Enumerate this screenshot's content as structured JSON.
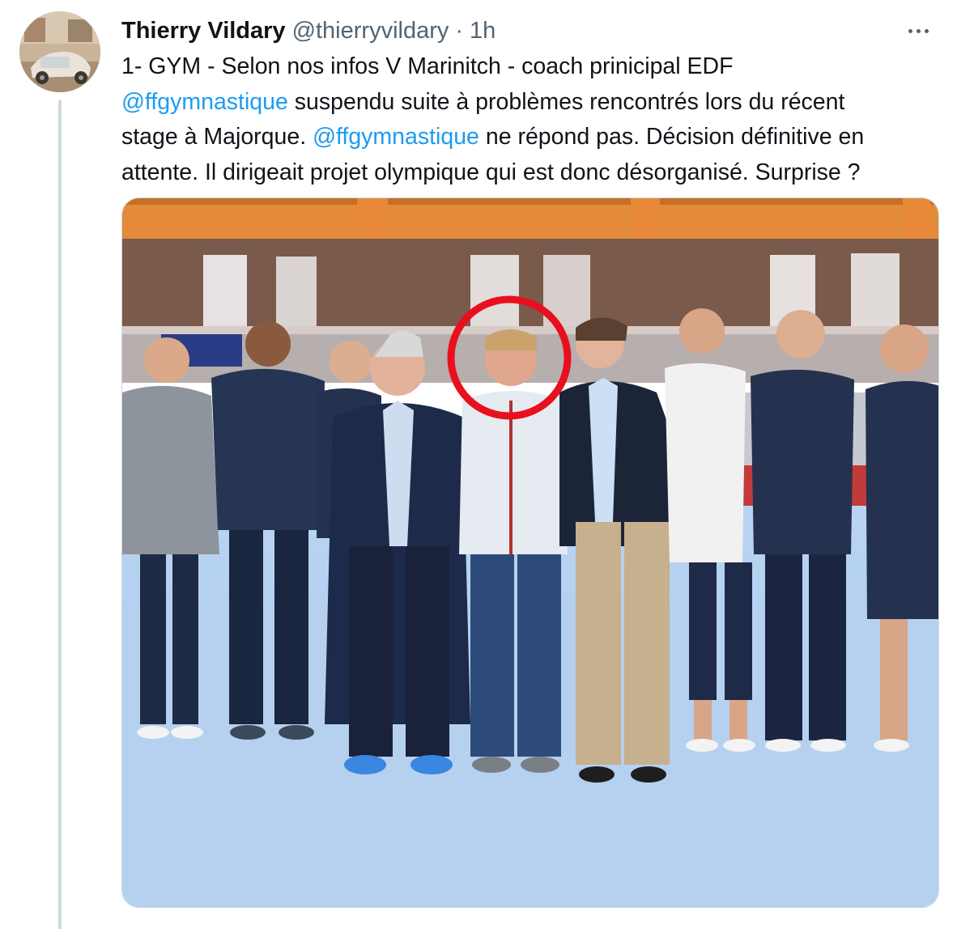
{
  "author": {
    "display_name": "Thierry Vildary",
    "handle": "@thierryvildary",
    "separator": "·",
    "time": "1h",
    "avatar_icon": "avatar-photo"
  },
  "more_icon": "more-horizontal-icon",
  "tweet": {
    "line1": "1- GYM - Selon nos infos V Marinitch - coach prinicipal EDF",
    "line2_mention": "@ffgymnastique",
    "line2_text": " suspendu suite à problèmes rencontrés lors du récent",
    "line3_text": "stage à Majorque. ",
    "line3_mention": "@ffgymnastique",
    "line3_rest": " ne répond pas. Décision définitive en",
    "line4": "attente. Il dirigeait projet olympique qui est donc désorganisé. Surprise ?"
  },
  "colors": {
    "mention": "#1d9bf0",
    "secondary_text": "#536471",
    "highlight_circle": "#e8101e",
    "thread_line": "#cfd9de"
  },
  "media": {
    "type": "photo",
    "description_icon": "team-photo-image"
  }
}
